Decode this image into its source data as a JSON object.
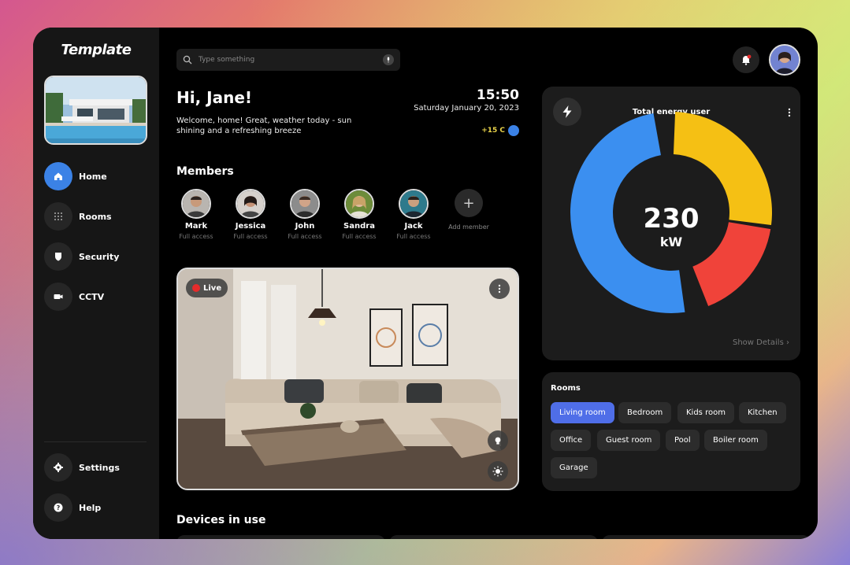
{
  "app": {
    "logo": "Template"
  },
  "sidebar": {
    "items": [
      {
        "label": "Home",
        "icon": "home-icon"
      },
      {
        "label": "Rooms",
        "icon": "grid-icon"
      },
      {
        "label": "Security",
        "icon": "shield-icon"
      },
      {
        "label": "CCTV",
        "icon": "camera-icon"
      }
    ],
    "bottom": [
      {
        "label": "Settings",
        "icon": "gear-icon"
      },
      {
        "label": "Help",
        "icon": "help-icon"
      }
    ]
  },
  "search": {
    "placeholder": "Type something"
  },
  "header": {
    "greeting": "Hi, Jane!",
    "welcome": "Welcome, home! Great, weather today - sun shining and a refreshing breeze",
    "time": "15:50",
    "date": "Saturday January 20, 2023",
    "temperature": "+15 C"
  },
  "members": {
    "title": "Members",
    "list": [
      {
        "name": "Mark",
        "role": "Full access"
      },
      {
        "name": "Jessica",
        "role": "Full access"
      },
      {
        "name": "John",
        "role": "Full access"
      },
      {
        "name": "Sandra",
        "role": "Full access"
      },
      {
        "name": "Jack",
        "role": "Full access"
      }
    ],
    "add_label": "Add member"
  },
  "camera": {
    "live_label": "Live"
  },
  "devices": {
    "title": "Devices in use"
  },
  "energy": {
    "title": "Total energy user",
    "value": "230",
    "unit": "kW",
    "show_details": "Show Details",
    "segments": [
      {
        "color": "#3b8ff0",
        "fraction": 0.5
      },
      {
        "color": "#f5c014",
        "fraction": 0.27
      },
      {
        "color": "#f0433a",
        "fraction": 0.17
      }
    ]
  },
  "rooms": {
    "title": "Rooms",
    "chips": [
      "Living room",
      "Bedroom",
      "Kids room",
      "Kitchen",
      "Office",
      "Guest room",
      "Pool",
      "Boiler room",
      "Garage"
    ],
    "active": "Living room"
  }
}
